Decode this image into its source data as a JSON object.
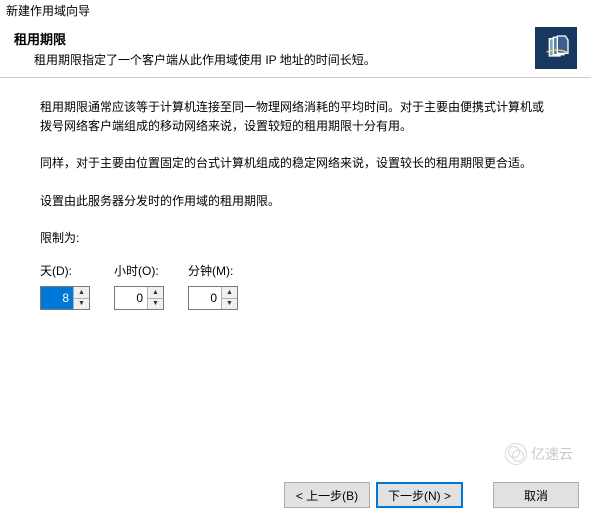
{
  "window_title": "新建作用域向导",
  "header": {
    "title": "租用期限",
    "description": "租用期限指定了一个客户端从此作用域使用 IP 地址的时间长短。"
  },
  "content": {
    "paragraph1": "租用期限通常应该等于计算机连接至同一物理网络消耗的平均时间。对于主要由便携式计算机或拨号网络客户端组成的移动网络来说，设置较短的租用期限十分有用。",
    "paragraph2": "同样，对于主要由位置固定的台式计算机组成的稳定网络来说，设置较长的租用期限更合适。",
    "paragraph3": "设置由此服务器分发时的作用域的租用期限。",
    "limit_label": "限制为:"
  },
  "inputs": {
    "days": {
      "label": "天(D):",
      "value": "8"
    },
    "hours": {
      "label": "小时(O):",
      "value": "0"
    },
    "minutes": {
      "label": "分钟(M):",
      "value": "0"
    }
  },
  "buttons": {
    "back": "< 上一步(B)",
    "next": "下一步(N) >",
    "cancel": "取消"
  },
  "watermark": "亿速云"
}
